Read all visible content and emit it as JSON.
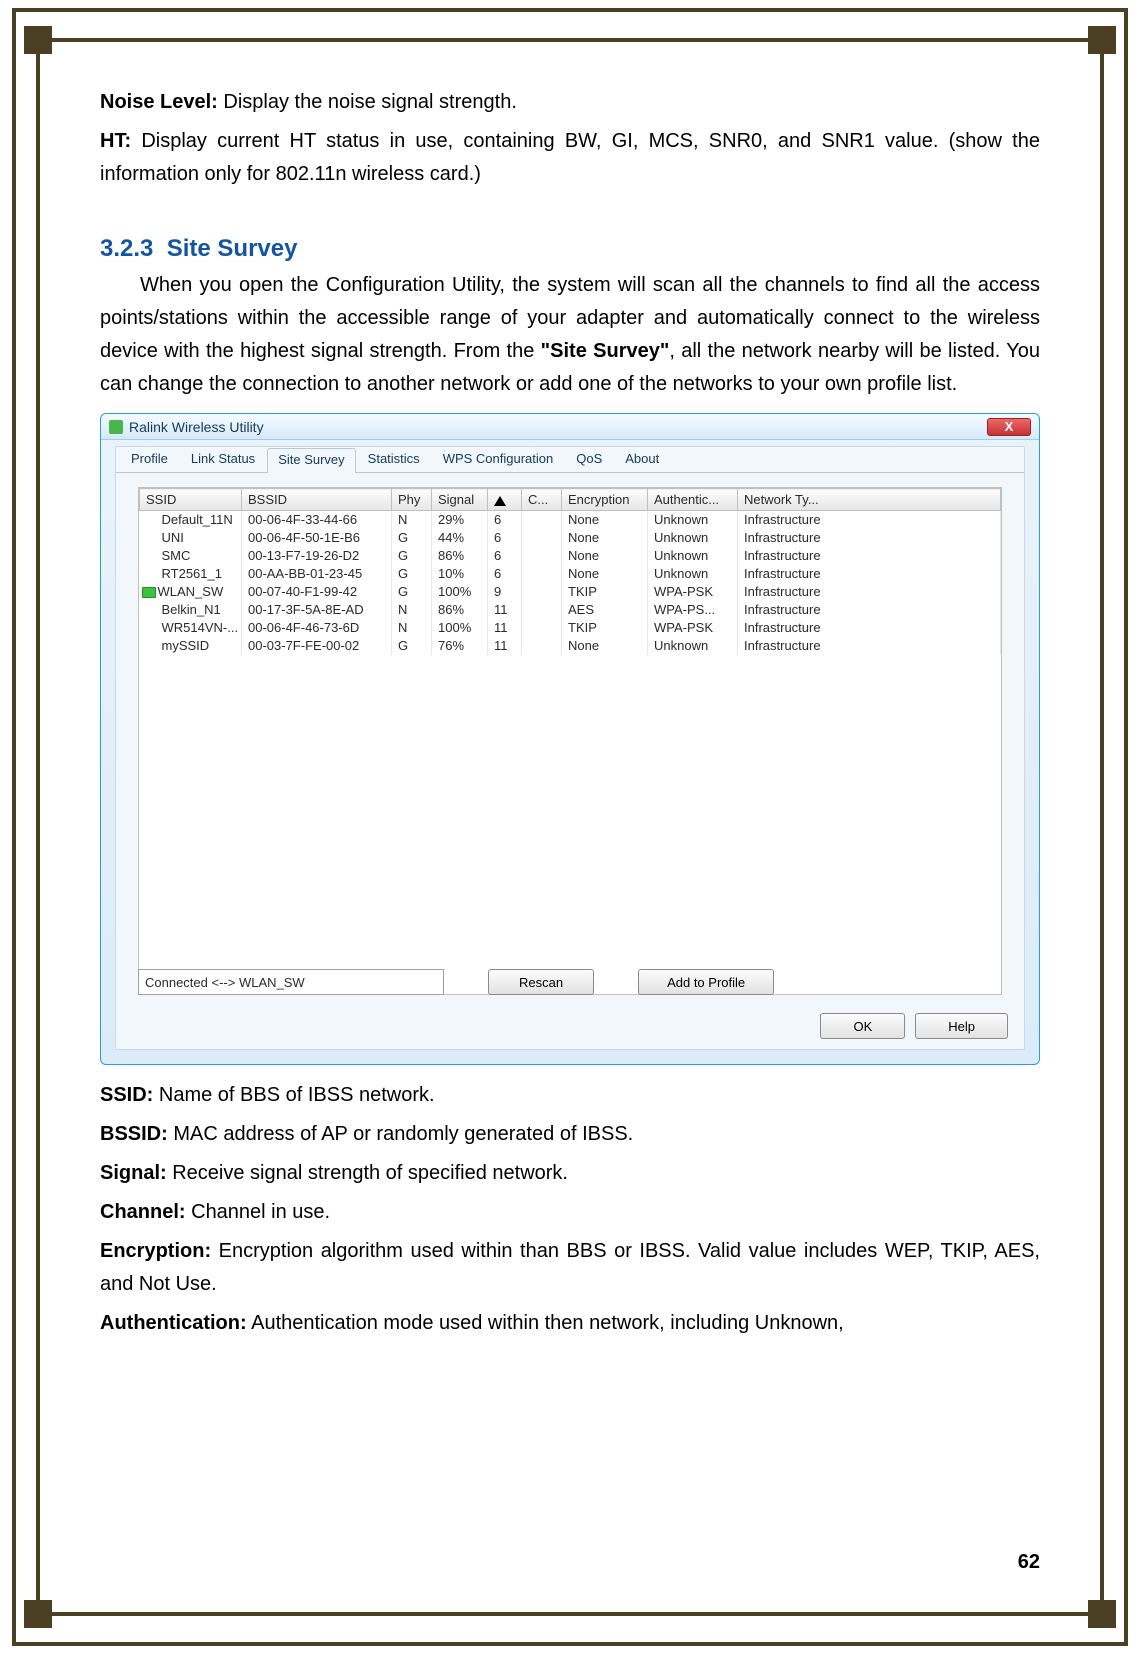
{
  "text": {
    "noise_label": "Noise Level:",
    "noise_desc": " Display the noise signal strength.",
    "ht_label": "HT:",
    "ht_desc": " Display current HT status in use, containing BW, GI, MCS, SNR0, and SNR1 value. (show the information only for 802.11n wireless card.)",
    "section_num": "3.2.3",
    "section_title": "Site Survey",
    "section_body1": "When you open the Configuration Utility, the system will scan all the channels to find all the access points/stations within the accessible range of your adapter and automatically connect to the wireless device with the highest signal strength. From the ",
    "section_body_bold": "\"Site Survey\"",
    "section_body2": ", all the network nearby will be listed. You can change the connection to another network or add one of the networks to your own profile list.",
    "ssid_label": "SSID:",
    "ssid_desc": " Name of BBS of IBSS network.",
    "bssid_label": "BSSID:",
    "bssid_desc": " MAC address of AP or randomly generated of IBSS.",
    "signal_label": "Signal:",
    "signal_desc": " Receive signal strength of specified network.",
    "channel_label": "Channel:",
    "channel_desc": " Channel in use.",
    "encryption_label": "Encryption:",
    "encryption_desc": " Encryption algorithm used within than BBS or IBSS. Valid value includes WEP, TKIP, AES, and Not Use.",
    "auth_label": "Authentication:",
    "auth_desc": " Authentication mode used within then network, including Unknown,",
    "page": "62"
  },
  "window": {
    "title": "Ralink Wireless Utility",
    "close": "X",
    "tabs": [
      "Profile",
      "Link Status",
      "Site Survey",
      "Statistics",
      "WPS Configuration",
      "QoS",
      "About"
    ],
    "active_tab": 2,
    "columns": [
      "SSID",
      "BSSID",
      "Phy",
      "Signal",
      "",
      "C...",
      "Encryption",
      "Authentic...",
      "Network Ty..."
    ],
    "rows": [
      {
        "ssid": "Default_11N",
        "bssid": "00-06-4F-33-44-66",
        "phy": "N",
        "signal": "29%",
        "sort": "6",
        "ch": "",
        "enc": "None",
        "auth": "Unknown",
        "nt": "Infrastructure",
        "connected": false
      },
      {
        "ssid": "UNI",
        "bssid": "00-06-4F-50-1E-B6",
        "phy": "G",
        "signal": "44%",
        "sort": "6",
        "ch": "",
        "enc": "None",
        "auth": "Unknown",
        "nt": "Infrastructure",
        "connected": false
      },
      {
        "ssid": "SMC",
        "bssid": "00-13-F7-19-26-D2",
        "phy": "G",
        "signal": "86%",
        "sort": "6",
        "ch": "",
        "enc": "None",
        "auth": "Unknown",
        "nt": "Infrastructure",
        "connected": false
      },
      {
        "ssid": "RT2561_1",
        "bssid": "00-AA-BB-01-23-45",
        "phy": "G",
        "signal": "10%",
        "sort": "6",
        "ch": "",
        "enc": "None",
        "auth": "Unknown",
        "nt": "Infrastructure",
        "connected": false
      },
      {
        "ssid": "WLAN_SW",
        "bssid": "00-07-40-F1-99-42",
        "phy": "G",
        "signal": "100%",
        "sort": "9",
        "ch": "",
        "enc": "TKIP",
        "auth": "WPA-PSK",
        "nt": "Infrastructure",
        "connected": true
      },
      {
        "ssid": "Belkin_N1",
        "bssid": "00-17-3F-5A-8E-AD",
        "phy": "N",
        "signal": "86%",
        "sort": "11",
        "ch": "",
        "enc": "AES",
        "auth": "WPA-PS...",
        "nt": "Infrastructure",
        "connected": false
      },
      {
        "ssid": "WR514VN-...",
        "bssid": "00-06-4F-46-73-6D",
        "phy": "N",
        "signal": "100%",
        "sort": "11",
        "ch": "",
        "enc": "TKIP",
        "auth": "WPA-PSK",
        "nt": "Infrastructure",
        "connected": false
      },
      {
        "ssid": "mySSID",
        "bssid": "00-03-7F-FE-00-02",
        "phy": "G",
        "signal": "76%",
        "sort": "11",
        "ch": "",
        "enc": "None",
        "auth": "Unknown",
        "nt": "Infrastructure",
        "connected": false
      }
    ],
    "status": "Connected <--> WLAN_SW",
    "rescan": "Rescan",
    "add_profile": "Add to Profile",
    "ok": "OK",
    "help": "Help"
  }
}
